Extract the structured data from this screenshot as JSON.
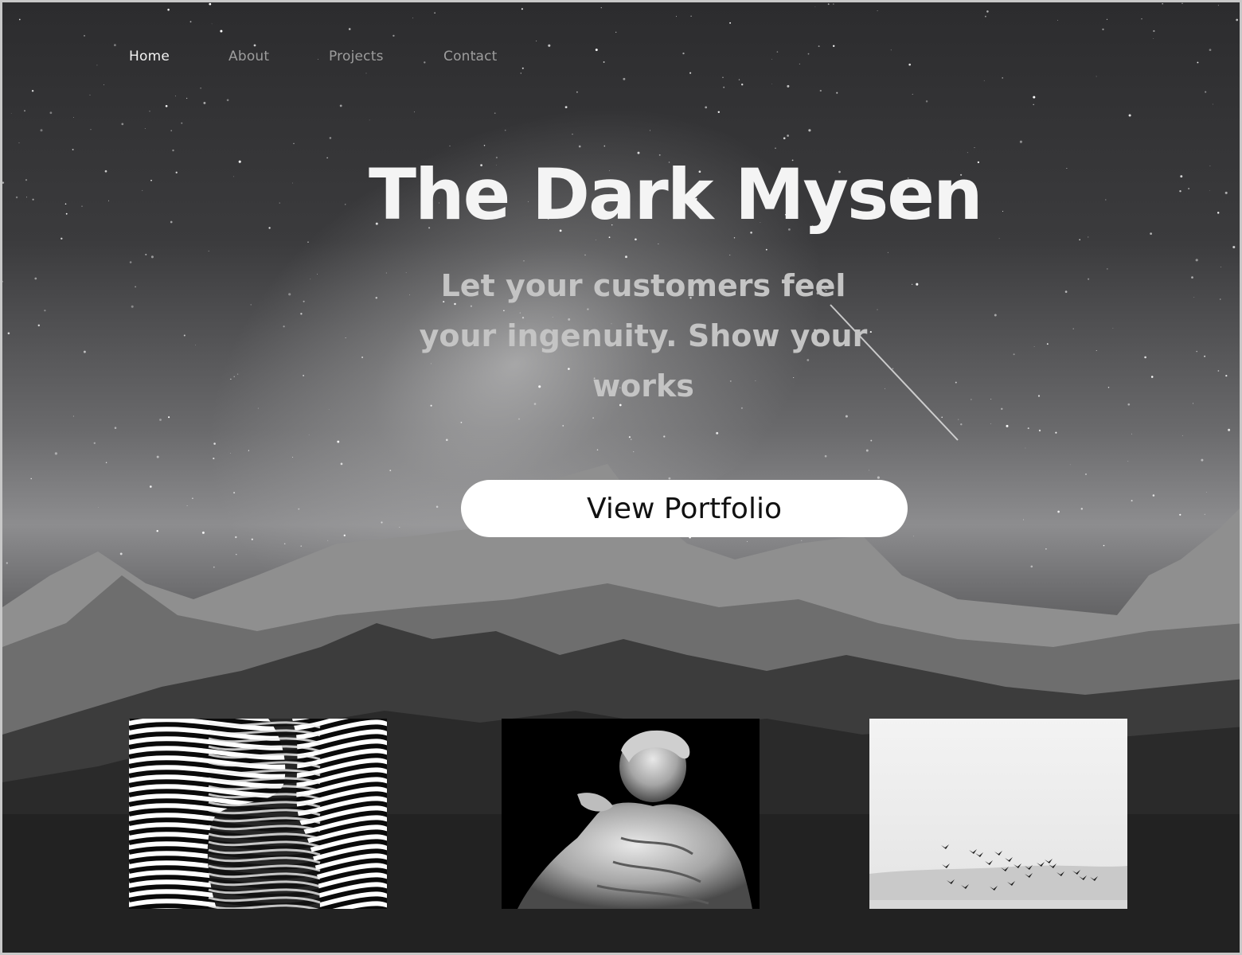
{
  "nav": {
    "items": [
      {
        "label": "Home",
        "active": true
      },
      {
        "label": "About",
        "active": false
      },
      {
        "label": "Projects",
        "active": false
      },
      {
        "label": "Contact",
        "active": false
      }
    ]
  },
  "hero": {
    "title": "The Dark Mysen",
    "subtitle_lines": [
      "Let your customers feel",
      "your ingenuity. Show your",
      "works"
    ],
    "cta_label": "View Portfolio"
  },
  "gallery": [
    {
      "icon": "wavy-lines-figure-image"
    },
    {
      "icon": "marble-statue-image"
    },
    {
      "icon": "flying-birds-image"
    }
  ],
  "colors": {
    "nav_active": "#f2f2f2",
    "nav_inactive": "#9d9d9d",
    "title": "#f4f4f4",
    "subtitle": "#c4c4c4",
    "cta_bg": "#ffffff",
    "cta_text": "#111111"
  }
}
